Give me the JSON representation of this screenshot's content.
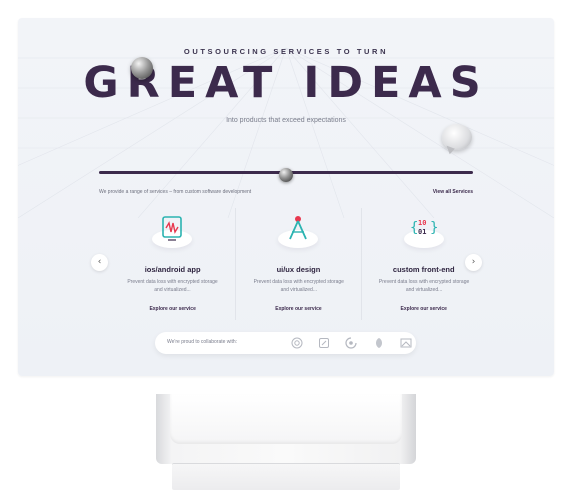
{
  "hero": {
    "eyebrow": "OUTSOURCING SERVICES TO TURN",
    "headline": "GREAT IDEAS",
    "tagline": "Into products that exceed expectations"
  },
  "services": {
    "intro": "We provide a range of services – from custom software development",
    "view_all": "View all Services",
    "items": [
      {
        "title": "ios/android app",
        "description": "Prevent data loss with encrypted storage and virtualized...",
        "link": "Explore our service",
        "icon": "mobile-app-icon"
      },
      {
        "title": "ui/ux design",
        "description": "Prevent data loss with encrypted storage and virtualized...",
        "link": "Explore our service",
        "icon": "compass-design-icon"
      },
      {
        "title": "custom front-end",
        "description": "Prevent data loss with encrypted storage and virtualized...",
        "link": "Explore our service",
        "icon": "binary-code-icon"
      }
    ]
  },
  "carousel": {
    "prev": "‹",
    "next": "›"
  },
  "partners": {
    "label": "We're proud to collaborate with:",
    "logos": [
      "partner-logo-1-icon",
      "partner-logo-2-icon",
      "partner-logo-3-icon",
      "partner-logo-4-icon",
      "partner-logo-5-icon"
    ]
  },
  "colors": {
    "brand": "#3c2a4c",
    "accent_teal": "#2bb3b1",
    "accent_red": "#e8384f",
    "screen_bg": "#f0f2f6"
  }
}
